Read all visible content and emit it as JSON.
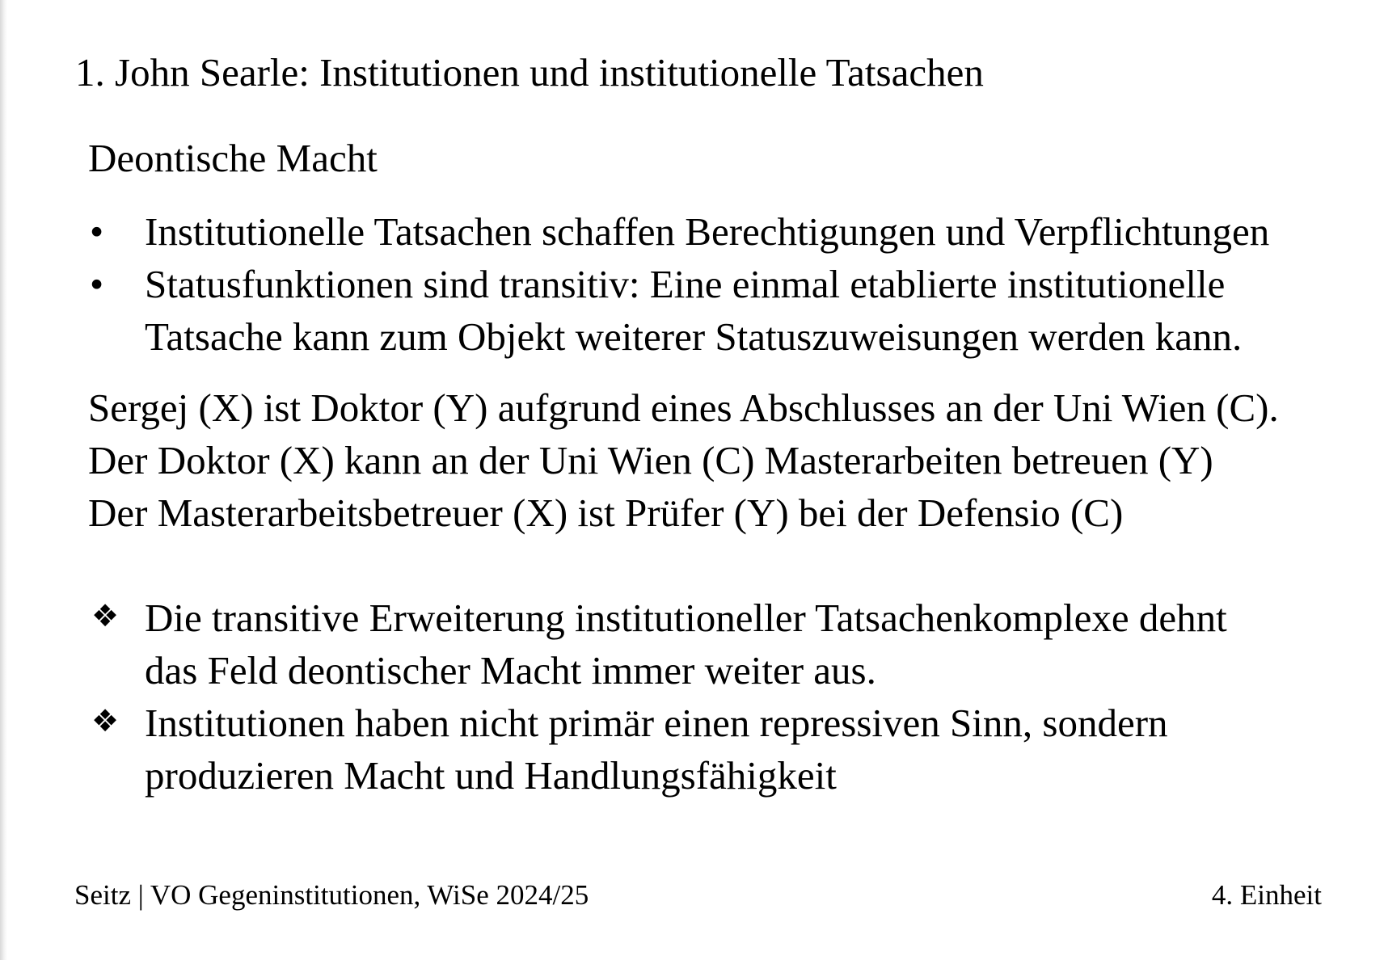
{
  "slide": {
    "title": "1. John Searle: Institutionen und institutionelle Tatsachen",
    "heading": "Deontische Macht",
    "bullets": [
      {
        "marker": "•",
        "lines": [
          "Institutionelle Tatsachen schaffen Berechtigungen und Verpflichtungen"
        ]
      },
      {
        "marker": "•",
        "lines": [
          "Statusfunktionen sind transitiv:  Eine einmal etablierte institutionelle",
          "Tatsache kann zum Objekt weiterer Statuszuweisungen werden kann."
        ]
      }
    ],
    "examples": [
      "Sergej (X) ist Doktor (Y) aufgrund eines Abschlusses an der Uni Wien (C).",
      "Der Doktor (X) kann an der Uni Wien (C) Masterarbeiten betreuen (Y)",
      "Der Masterarbeitsbetreuer (X) ist Prüfer (Y) bei der Defensio (C)"
    ],
    "conclusions": [
      {
        "marker": "❖",
        "lines": [
          "Die transitive Erweiterung institutioneller Tatsachenkomplexe dehnt",
          "das Feld deontischer Macht immer weiter aus."
        ]
      },
      {
        "marker": "❖",
        "lines": [
          "Institutionen haben nicht primär einen repressiven Sinn, sondern",
          "produzieren Macht und Handlungsfähigkeit"
        ]
      }
    ]
  },
  "footer": {
    "left": "Seitz | VO Gegeninstitutionen, WiSe 2024/25",
    "right": "4. Einheit"
  }
}
